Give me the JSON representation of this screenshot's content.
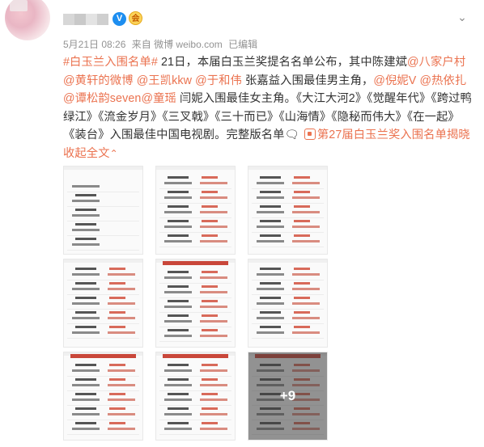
{
  "post": {
    "date": "5月21日 08:26",
    "source": "来自 微博 weibo.com",
    "edited": "已编辑",
    "more_menu": "⌄",
    "verified_mark": "V",
    "badge_mark": "会"
  },
  "content": {
    "hashtag": "#白玉兰入围名单#",
    "t1": " 21日，本届白玉兰奖提名名单公布，其中陈建斌",
    "m_bajiahucun": "@八家户村",
    "m_huangxuan": "@黄轩的微博",
    "m_wangkai": "@王凯kkw",
    "m_yuhewei": "@于和伟",
    "t2": " 张嘉益入围最佳男主角，",
    "m_nini": "@倪妮V",
    "m_reyizha": "@热依扎",
    "m_tansongyun": "@谭松韵seven",
    "m_tongyao": "@童瑶",
    "t3": " 闫妮入围最佳女主角。《大江大河2》《觉醒年代》《跨过鸭绿江》《流金岁月》《三叉戟》《三十而已》《山海情》《隐秘而伟大》《在一起》《装台》入围最佳中国电视剧。完整版名单",
    "emoji": "🗨",
    "link_text": "第27届白玉兰奖入围名单揭晓",
    "expand": "收起全文",
    "expand_chev": "⌃"
  },
  "gallery": {
    "more_count": "+9"
  },
  "colors": {
    "link": "#eb7350",
    "verified": "#1d8ef0"
  }
}
